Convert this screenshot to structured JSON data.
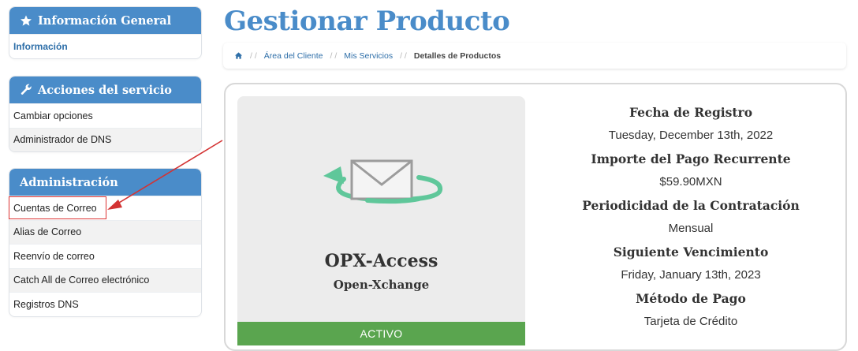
{
  "sidebar": {
    "info_panel": {
      "title": "Información General",
      "items": [
        "Información"
      ]
    },
    "service_panel": {
      "title": "Acciones del servicio",
      "items": [
        "Cambiar opciones",
        "Administrador de DNS"
      ]
    },
    "admin_panel": {
      "title": "Administración",
      "items": [
        "Cuentas de Correo",
        "Alias de Correo",
        "Reenvío de correo",
        "Catch All de Correo electrónico",
        "Registros DNS"
      ]
    }
  },
  "main": {
    "title": "Gestionar Producto",
    "breadcrumb": {
      "items": [
        "Área del Cliente",
        "Mis Servicios"
      ],
      "current": "Detalles de Productos"
    },
    "product": {
      "name": "OPX-Access",
      "group": "Open-Xchange",
      "status": "ACTIVO"
    },
    "details": [
      {
        "label": "Fecha de Registro",
        "value": "Tuesday, December 13th, 2022"
      },
      {
        "label": "Importe del Pago Recurrente",
        "value": "$59.90MXN"
      },
      {
        "label": "Periodicidad de la Contratación",
        "value": "Mensual"
      },
      {
        "label": "Siguiente Vencimiento",
        "value": "Friday, January 13th, 2023"
      },
      {
        "label": "Método de Pago",
        "value": "Tarjeta de Crédito"
      }
    ]
  },
  "colors": {
    "accent": "#4a8cc9",
    "active": "#5aa54f",
    "annotation": "#d33333"
  }
}
